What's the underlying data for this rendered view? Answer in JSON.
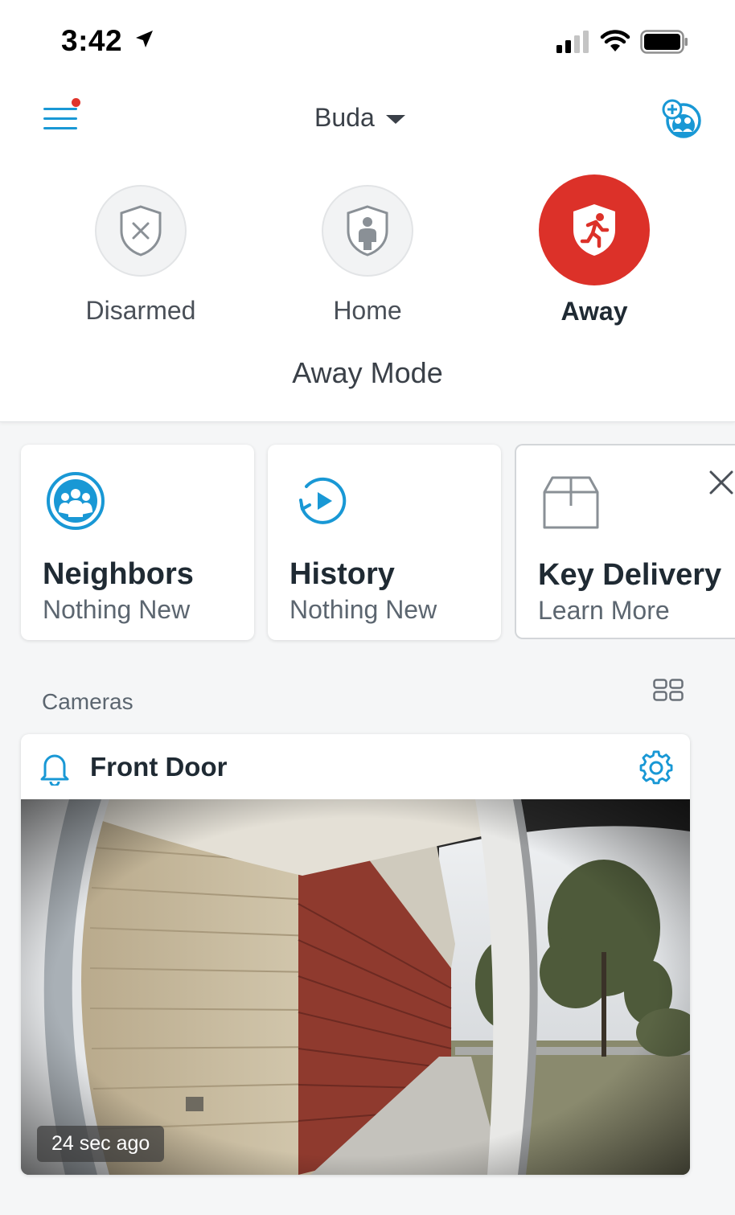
{
  "status_bar": {
    "time": "3:42"
  },
  "header": {
    "location": "Buda"
  },
  "modes": [
    {
      "label": "Disarmed",
      "icon": "shield-x-icon",
      "active": false
    },
    {
      "label": "Home",
      "icon": "shield-person-icon",
      "active": false
    },
    {
      "label": "Away",
      "icon": "shield-running-icon",
      "active": true
    }
  ],
  "mode_description": "Away Mode",
  "cards": [
    {
      "title": "Neighbors",
      "subtitle": "Nothing New",
      "icon": "neighbors-icon"
    },
    {
      "title": "History",
      "subtitle": "Nothing New",
      "icon": "history-icon"
    },
    {
      "title": "Key Delivery",
      "subtitle": "Learn More",
      "icon": "package-icon"
    }
  ],
  "cameras": {
    "section_title": "Cameras",
    "items": [
      {
        "name": "Front Door",
        "last_updated": "24 sec ago"
      }
    ]
  },
  "colors": {
    "accent": "#1998d5",
    "away_red": "#dc3129",
    "notification_dot": "#e0342b"
  }
}
